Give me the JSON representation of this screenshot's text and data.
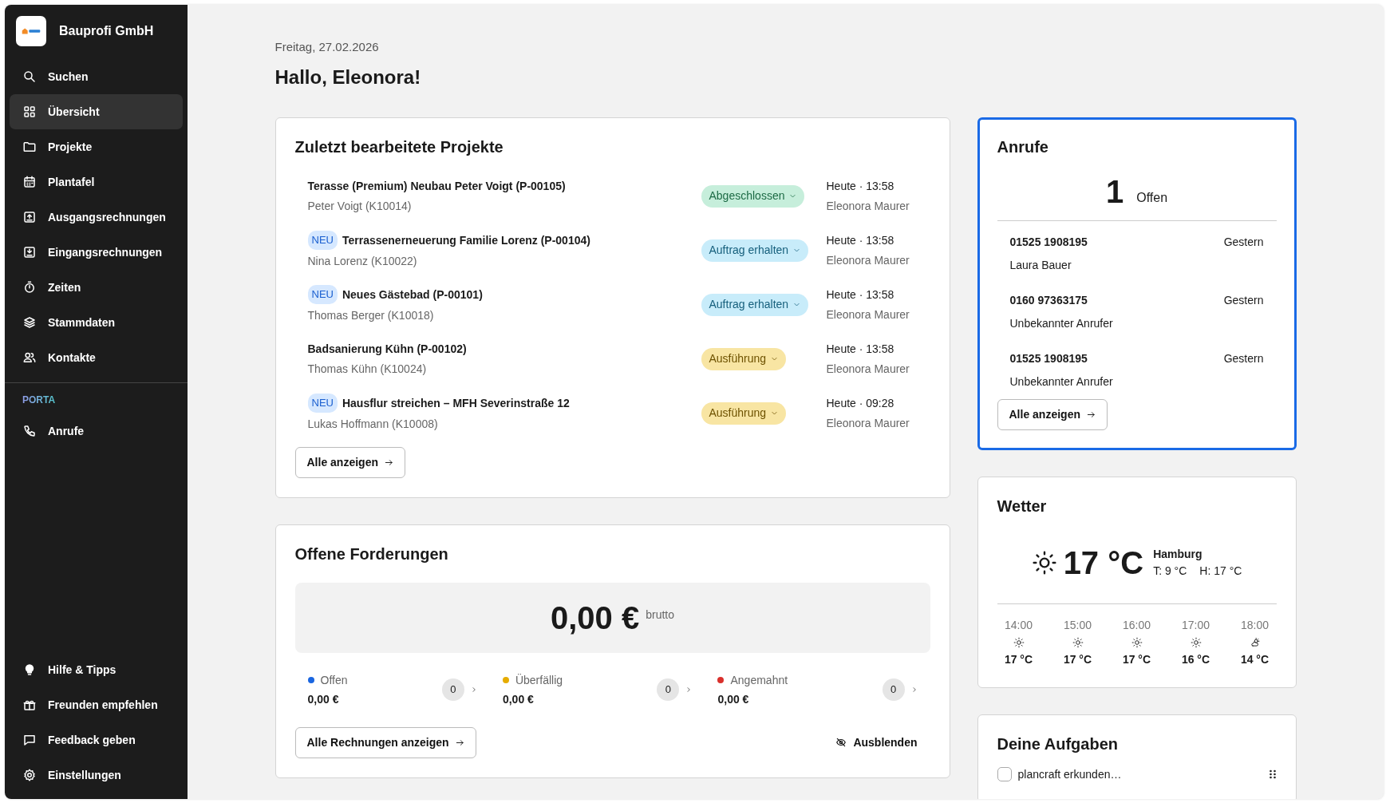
{
  "sidebar": {
    "company": "Bauprofi GmbH",
    "items": [
      {
        "label": "Suchen",
        "selected": false
      },
      {
        "label": "Übersicht",
        "selected": true
      },
      {
        "label": "Projekte",
        "selected": false
      },
      {
        "label": "Plantafel",
        "selected": false
      },
      {
        "label": "Ausgangsrechnungen",
        "selected": false
      },
      {
        "label": "Eingangsrechnungen",
        "selected": false
      },
      {
        "label": "Zeiten",
        "selected": false
      },
      {
        "label": "Stammdaten",
        "selected": false
      },
      {
        "label": "Kontakte",
        "selected": false
      }
    ],
    "section_label": "PORTA",
    "section_items": [
      {
        "label": "Anrufe",
        "selected": false
      }
    ],
    "footer_items": [
      {
        "label": "Hilfe & Tipps"
      },
      {
        "label": "Freunden empfehlen"
      },
      {
        "label": "Feedback geben"
      },
      {
        "label": "Einstellungen"
      }
    ]
  },
  "date": "Freitag, 27.02.2026",
  "greeting": "Hallo, Eleonora!",
  "projects": {
    "title": "Zuletzt bearbeitete Projekte",
    "rows": [
      {
        "new_badge": null,
        "name": "Terasse (Premium) Neubau Peter Voigt (P-00105)",
        "customer": "Peter Voigt (K10014)",
        "status": {
          "label": "Abgeschlossen",
          "kind": "done"
        },
        "time": "Heute · 13:58",
        "user": "Eleonora Maurer"
      },
      {
        "new_badge": "NEU",
        "name": "Terrassenerneuerung Familie Lorenz (P-00104)",
        "customer": "Nina Lorenz (K10022)",
        "status": {
          "label": "Auftrag erhalten",
          "kind": "ordered"
        },
        "time": "Heute · 13:58",
        "user": "Eleonora Maurer"
      },
      {
        "new_badge": "NEU",
        "name": "Neues Gästebad (P-00101)",
        "customer": "Thomas Berger (K10018)",
        "status": {
          "label": "Auftrag erhalten",
          "kind": "ordered"
        },
        "time": "Heute · 13:58",
        "user": "Eleonora Maurer"
      },
      {
        "new_badge": null,
        "name": "Badsanierung Kühn (P-00102)",
        "customer": "Thomas Kühn (K10024)",
        "status": {
          "label": "Ausführung",
          "kind": "execution"
        },
        "time": "Heute · 13:58",
        "user": "Eleonora Maurer"
      },
      {
        "new_badge": "NEU",
        "name": "Hausflur streichen – MFH Severinstraße 12",
        "customer": "Lukas Hoffmann (K10008)",
        "status": {
          "label": "Ausführung",
          "kind": "execution"
        },
        "time": "Heute · 09:28",
        "user": "Eleonora Maurer"
      }
    ],
    "button": "Alle anzeigen"
  },
  "receivables": {
    "title": "Offene Forderungen",
    "total": "0,00 €",
    "total_note": "brutto",
    "groups": [
      {
        "label": "Offen",
        "color": "#1a66e0",
        "amount": "0,00 €",
        "count": "0"
      },
      {
        "label": "Überfällig",
        "color": "#e6ac00",
        "amount": "0,00 €",
        "count": "0"
      },
      {
        "label": "Angemahnt",
        "color": "#d9302c",
        "amount": "0,00 €",
        "count": "0"
      }
    ],
    "button": "Alle Rechnungen anzeigen",
    "hide_link": "Ausblenden"
  },
  "calls": {
    "title": "Anrufe",
    "highlighted": true,
    "open_count": "1",
    "open_label": "Offen",
    "items": [
      {
        "number": "01525 1908195",
        "when": "Gestern",
        "caller": "Laura Bauer"
      },
      {
        "number": "0160 97363175",
        "when": "Gestern",
        "caller": "Unbekannter Anrufer"
      },
      {
        "number": "01525 1908195",
        "when": "Gestern",
        "caller": "Unbekannter Anrufer"
      }
    ],
    "button": "Alle anzeigen"
  },
  "weather": {
    "title": "Wetter",
    "kind": "sunny",
    "temperature": "17 °C",
    "city": "Hamburg",
    "low": "T: 9 °C",
    "high": "H: 17 °C",
    "hours": [
      {
        "time": "14:00",
        "kind": "sunny",
        "temp": "17 °C"
      },
      {
        "time": "15:00",
        "kind": "sunny",
        "temp": "17 °C"
      },
      {
        "time": "16:00",
        "kind": "sunny",
        "temp": "17 °C"
      },
      {
        "time": "17:00",
        "kind": "sunny",
        "temp": "16 °C"
      },
      {
        "time": "18:00",
        "kind": "partly-cloudy",
        "temp": "14 °C"
      }
    ]
  },
  "tasks": {
    "title": "Deine Aufgaben",
    "items": [
      {
        "label": "plancraft erkunden…",
        "checked": false
      }
    ]
  }
}
